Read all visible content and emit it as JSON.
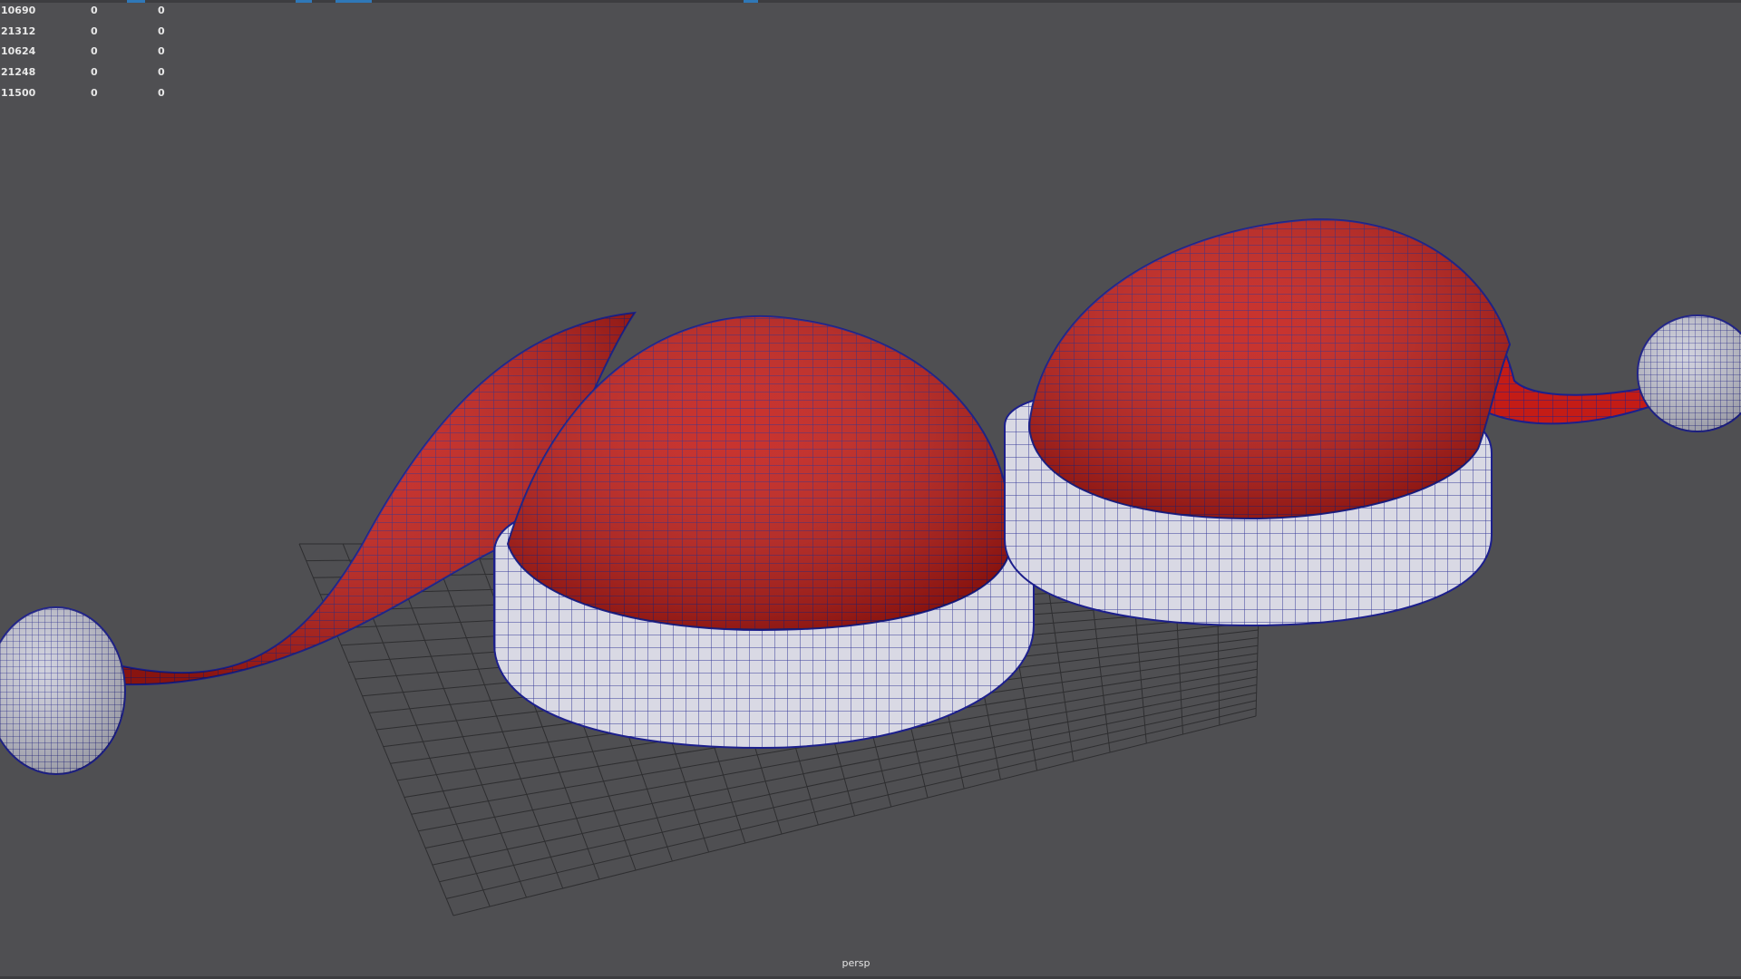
{
  "viewport": {
    "camera": "persp",
    "background": "#4f4f52"
  },
  "hud_stats": {
    "rows": [
      {
        "c1": "10690",
        "c2": "0",
        "c3": "0"
      },
      {
        "c1": "21312",
        "c2": "0",
        "c3": "0"
      },
      {
        "c1": "10624",
        "c2": "0",
        "c3": "0"
      },
      {
        "c1": "21248",
        "c2": "0",
        "c3": "0"
      },
      {
        "c1": "11500",
        "c2": "0",
        "c3": "0"
      }
    ]
  },
  "colors": {
    "hat_body": "#c41c16",
    "hat_trim": "#d9d9e4",
    "wireframe": "#1c1f8c",
    "grid": "#2e2e30",
    "text": "#e8e8e8"
  },
  "icons": {
    "status_marks": "status-mark-icon"
  }
}
